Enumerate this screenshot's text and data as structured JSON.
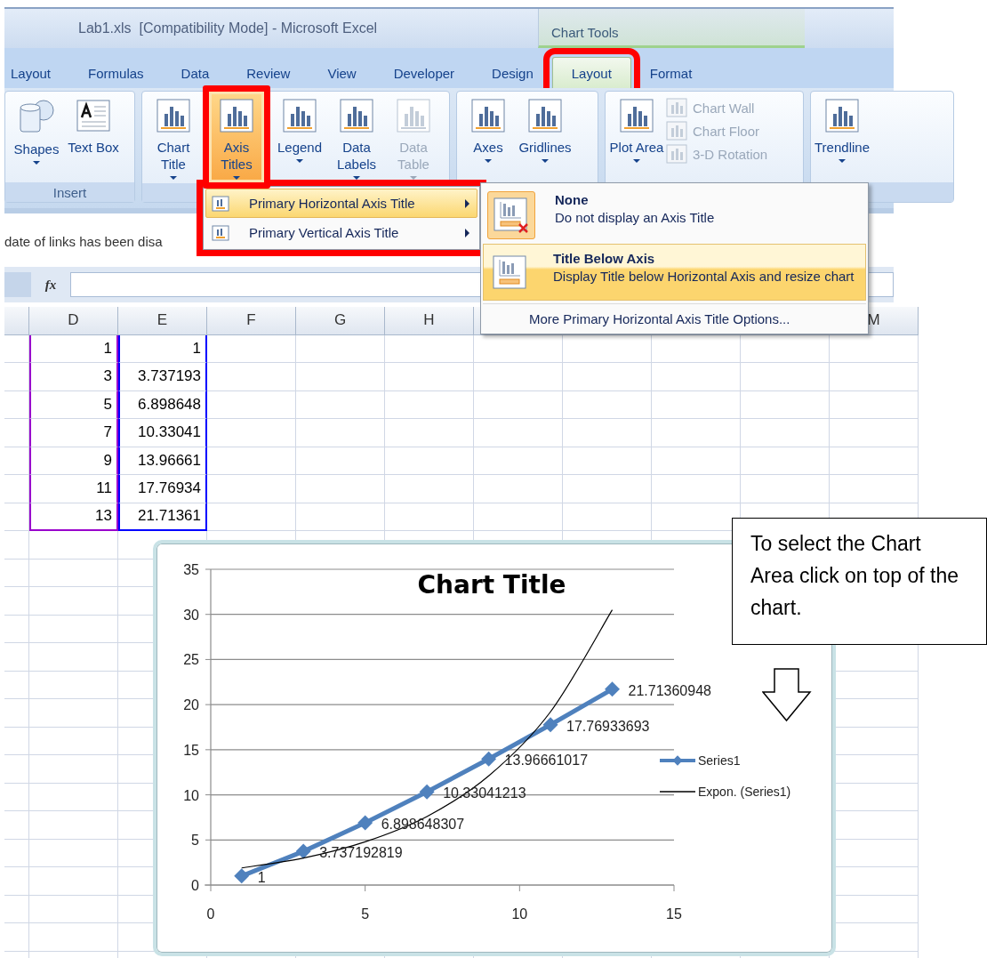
{
  "window": {
    "title": "Lab1.xls  [Compatibility Mode] - Microsoft Excel",
    "context_group": "Chart Tools"
  },
  "tabs": [
    {
      "label": "Layout",
      "selected": false,
      "marked": false
    },
    {
      "label": "Formulas",
      "selected": false,
      "marked": false
    },
    {
      "label": "Data",
      "selected": false,
      "marked": false
    },
    {
      "label": "Review",
      "selected": false,
      "marked": false
    },
    {
      "label": "View",
      "selected": false,
      "marked": false
    },
    {
      "label": "Developer",
      "selected": false,
      "marked": false
    },
    {
      "label": "Design",
      "selected": false,
      "marked": false
    },
    {
      "label": "Layout",
      "selected": true,
      "marked": true
    },
    {
      "label": "Format",
      "selected": false,
      "marked": false
    }
  ],
  "ribbon": {
    "groups": [
      {
        "label": "Insert",
        "buttons": [
          {
            "label": "Shapes",
            "active": false,
            "disabled": false,
            "marked": false
          },
          {
            "label": "Text Box",
            "active": false,
            "disabled": false,
            "marked": false
          }
        ]
      },
      {
        "buttons": [
          {
            "label": "Chart Title",
            "active": false,
            "disabled": false,
            "marked": false
          },
          {
            "label": "Axis Titles",
            "active": true,
            "disabled": false,
            "marked": true
          },
          {
            "label": "Legend",
            "active": false,
            "disabled": false,
            "marked": false
          },
          {
            "label": "Data Labels",
            "active": false,
            "disabled": false,
            "marked": false
          },
          {
            "label": "Data Table",
            "active": false,
            "disabled": true,
            "marked": false
          }
        ]
      },
      {
        "buttons": [
          {
            "label": "Axes",
            "active": false,
            "disabled": false,
            "marked": false
          },
          {
            "label": "Gridlines",
            "active": false,
            "disabled": false,
            "marked": false
          }
        ]
      },
      {
        "buttons": [
          {
            "label": "Plot Area",
            "active": false,
            "disabled": false,
            "marked": false
          }
        ],
        "small_buttons": [
          {
            "label": "Chart Wall",
            "disabled": true
          },
          {
            "label": "Chart Floor",
            "disabled": true
          },
          {
            "label": "3-D Rotation",
            "disabled": true
          }
        ]
      },
      {
        "buttons": [
          {
            "label": "Trendline",
            "active": false,
            "disabled": false,
            "marked": false
          }
        ]
      }
    ]
  },
  "message_bar": {
    "text": "date of links has been disa"
  },
  "formula_bar": {
    "function_label": "fx"
  },
  "sheet": {
    "columns": [
      "D",
      "E",
      "F",
      "G",
      "H",
      null,
      null,
      null,
      null,
      "M"
    ],
    "rows": [
      [
        "1",
        "1"
      ],
      [
        "3",
        "3.737193"
      ],
      [
        "5",
        "6.898648"
      ],
      [
        "7",
        "10.33041"
      ],
      [
        "9",
        "13.96661"
      ],
      [
        "11",
        "17.76934"
      ],
      [
        "13",
        "21.71361"
      ]
    ]
  },
  "axis_titles_menu": {
    "marked": true,
    "items": [
      {
        "label": "Primary Horizontal Axis Title",
        "selected": true
      },
      {
        "label": "Primary Vertical Axis Title",
        "selected": false
      }
    ]
  },
  "axis_title_submenu": {
    "items": [
      {
        "title": "None",
        "description": "Do not display an Axis Title",
        "current": true,
        "selected": false
      },
      {
        "title": "Title Below Axis",
        "description": "Display Title below Horizontal Axis and resize chart",
        "current": false,
        "selected": true
      }
    ],
    "footer": "More Primary Horizontal Axis Title Options..."
  },
  "chart": {
    "chart_data": {
      "type": "line",
      "title": "Chart Title",
      "x": [
        1,
        3,
        5,
        7,
        9,
        11,
        13
      ],
      "series": [
        {
          "name": "Series1",
          "color": "#4f81bd",
          "marker": "diamond",
          "values": [
            1,
            3.74,
            6.9,
            10.33,
            13.97,
            17.77,
            21.71
          ]
        },
        {
          "name": "Expon. (Series1)",
          "color": "#000000",
          "values": [
            1.9,
            3,
            4.8,
            7.6,
            12.1,
            19.2,
            30.5
          ]
        }
      ],
      "grid": true,
      "legend": true,
      "xlim": [
        0,
        15
      ],
      "ylim": [
        0,
        35
      ],
      "xticks": [
        0,
        5,
        10,
        15
      ],
      "yticks": [
        0,
        5,
        10,
        15,
        20,
        25,
        30,
        35
      ],
      "value_labels": [
        "1",
        "3.737192819",
        "6.898648307",
        "10.33041213",
        "13.96661017",
        "17.76933693",
        "21.71360948"
      ]
    }
  },
  "callout": {
    "text": "To select the Chart Area click on top of the chart."
  }
}
